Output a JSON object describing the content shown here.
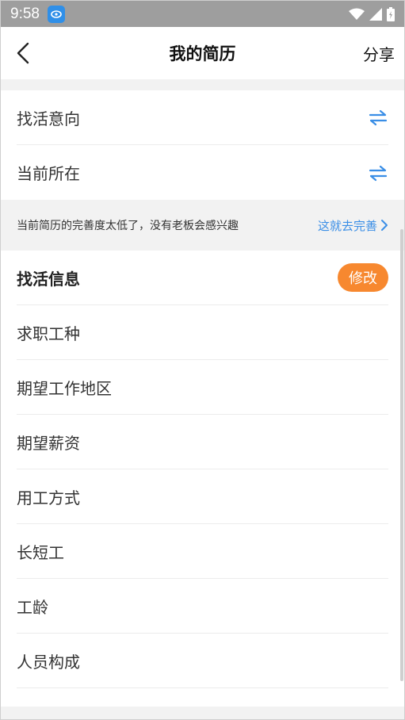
{
  "status_bar": {
    "time": "9:58"
  },
  "nav": {
    "title": "我的简历",
    "share_label": "分享"
  },
  "toggle_rows": [
    {
      "label": "找活意向"
    },
    {
      "label": "当前所在"
    }
  ],
  "notice": {
    "text": "当前简历的完善度太低了，没有老板会感兴趣",
    "link": "这就去完善"
  },
  "job_info": {
    "title": "找活信息",
    "edit_label": "修改",
    "fields": [
      "求职工种",
      "期望工作地区",
      "期望薪资",
      "用工方式",
      "长短工",
      "工龄",
      "人员构成"
    ]
  },
  "colors": {
    "accent_blue": "#3a8ee6",
    "edit_orange": "#f7882f",
    "status_gray": "#9e9e9e"
  }
}
